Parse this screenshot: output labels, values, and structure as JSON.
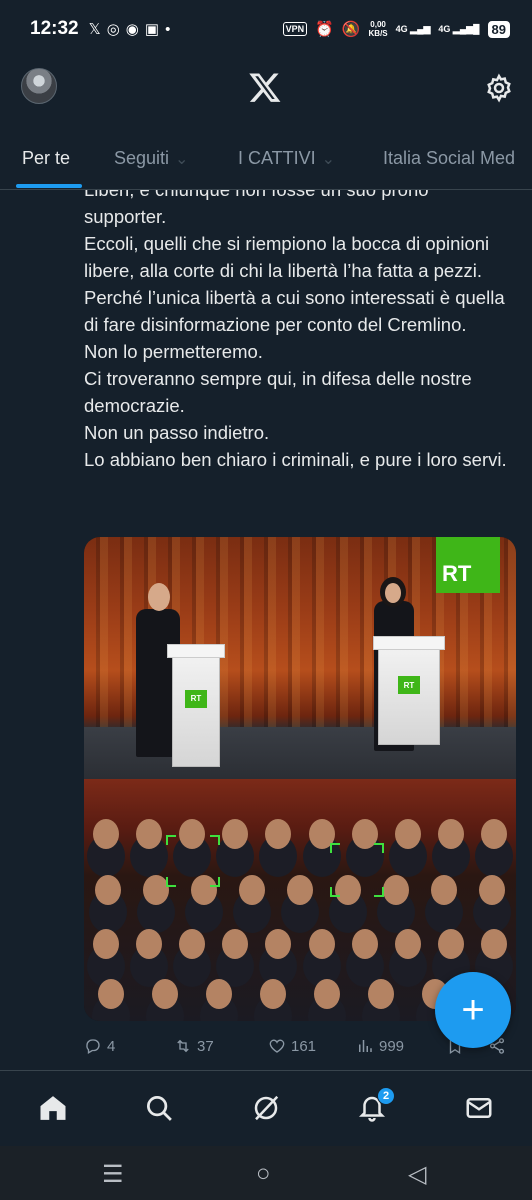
{
  "status_bar": {
    "time": "12:32",
    "vpn": "VPN",
    "net_speed_value": "0,00",
    "net_speed_unit": "KB/S",
    "signal1": "4G",
    "signal2": "4G",
    "battery": "89"
  },
  "header": {
    "logo_icon": "x-logo-icon",
    "settings_icon": "gear-icon"
  },
  "tabs": [
    {
      "label": "Per te",
      "active": true
    },
    {
      "label": "Seguiti"
    },
    {
      "label": "I CATTIVI"
    },
    {
      "label": "Italia Social Med"
    }
  ],
  "tweet": {
    "cut_line": "Liberi, e chiunque non fosse un suo prono",
    "paragraphs": [
      "supporter.",
      "Eccoli, quelli che si riempiono la bocca di opinioni libere, alla corte di chi la libertà l’ha fatta a pezzi. Perché l’unica libertà a cui sono interessati è quella di fare disinformazione per conto del Cremlino.",
      "Non lo permetteremo.",
      "Ci troveranno sempre qui, in difesa delle nostre democrazie.",
      "Non un passo indietro.",
      "Lo abbiano ben chiaro i criminali, e pure i loro servi."
    ],
    "media": {
      "rt_logo": "RT"
    },
    "actions": {
      "replies": "4",
      "reposts": "37",
      "likes": "161",
      "views": "999"
    }
  },
  "fab": {
    "label": "+"
  },
  "bottom_nav": {
    "notifications_badge": "2"
  }
}
